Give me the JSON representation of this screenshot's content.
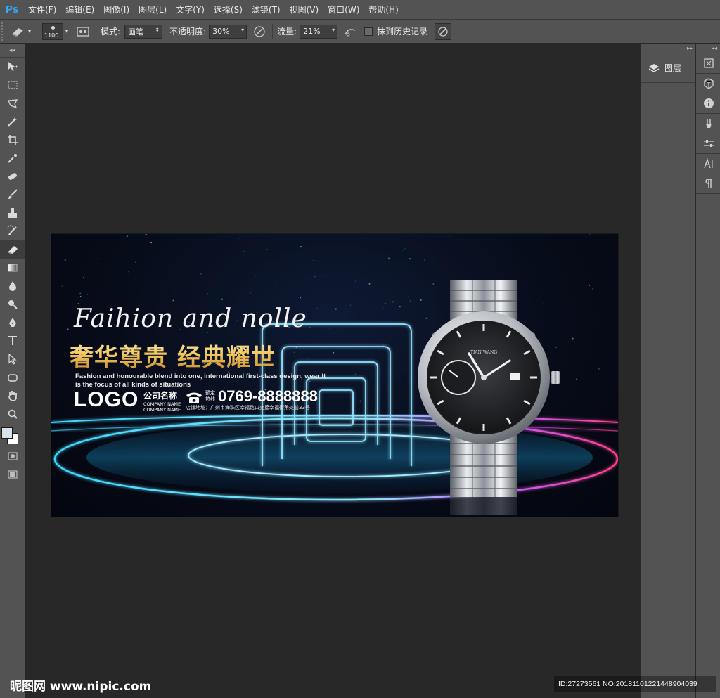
{
  "app": {
    "logo": "Ps",
    "menu": [
      "文件(F)",
      "编辑(E)",
      "图像(I)",
      "图层(L)",
      "文字(Y)",
      "选择(S)",
      "滤镜(T)",
      "视图(V)",
      "窗口(W)",
      "帮助(H)"
    ]
  },
  "options": {
    "brush_size": "1100",
    "mode_label": "模式:",
    "mode_value": "画笔",
    "opacity_label": "不透明度:",
    "opacity_value": "30%",
    "flow_label": "流量:",
    "flow_value": "21%",
    "erase_history_label": "抹到历史记录"
  },
  "panels": {
    "layers_label": "图层"
  },
  "banner": {
    "script_text": "Faihion and nolle",
    "title": "奢华尊贵 经典耀世",
    "description": "Fashion and honourable blend into one, international first-class design, wear It is the focus of all kinds of situations",
    "logo": "LOGO",
    "company_cn": "公司名称",
    "company_en_1": "COMPANY NAME",
    "company_en_2": "COMPANY NAME",
    "hotline_label": "预定热线",
    "phone": "0769-8888888",
    "address": "店铺地址：广州市海珠区幸福路口交接幸福街角处前33号",
    "watch_brand": "TIAN WANG"
  },
  "watermark": {
    "site": "昵图网 www.nipic.com",
    "id": "ID:27273561 NO:20181101221448904039"
  },
  "colors": {
    "ps_blue": "#31a8ff",
    "ui_gray": "#535353",
    "canvas_bg": "#282828",
    "gold": "#f1c862",
    "neon_cyan": "#3fd6ff",
    "neon_pink": "#ff3f8a"
  }
}
